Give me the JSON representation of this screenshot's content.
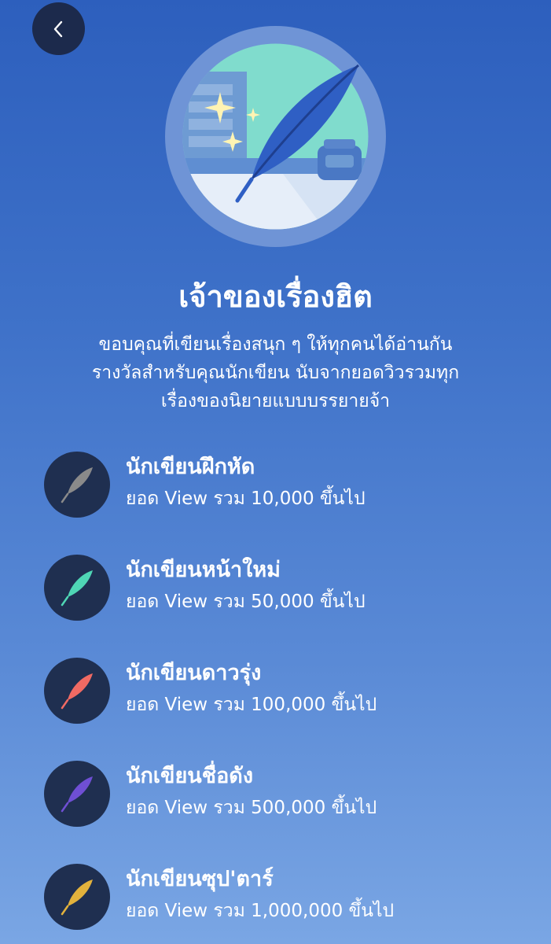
{
  "header": {
    "back_icon": "chevron-left-icon"
  },
  "badge": {
    "icon": "quill-feather-badge-icon"
  },
  "title": "เจ้าของเรื่องฮิต",
  "description": {
    "line1": "ขอบคุณที่เขียนเรื่องสนุก ๆ ให้ทุกคนได้อ่านกัน",
    "line2": "รางวัลสำหรับคุณนักเขียน นับจากยอดวิวรวมทุก",
    "line3": "เรื่องของนิยายแบบบรรยายจ้า"
  },
  "tiers": [
    {
      "name": "นักเขียนฝึกหัด",
      "requirement": "ยอด View รวม 10,000 ขึ้นไป",
      "color": "#8a8a8a",
      "icon": "feather-icon"
    },
    {
      "name": "นักเขียนหน้าใหม่",
      "requirement": "ยอด View รวม 50,000 ขึ้นไป",
      "color": "#4fd6b5",
      "icon": "feather-icon"
    },
    {
      "name": "นักเขียนดาวรุ่ง",
      "requirement": "ยอด View รวม 100,000 ขึ้นไป",
      "color": "#f06a63",
      "icon": "feather-icon"
    },
    {
      "name": "นักเขียนชื่อดัง",
      "requirement": "ยอด View รวม 500,000 ขึ้นไป",
      "color": "#6f4fd4",
      "icon": "feather-icon"
    },
    {
      "name": "นักเขียนซุป'ตาร์",
      "requirement": "ยอด View รวม 1,000,000 ขึ้นไป",
      "color": "#e2b23c",
      "icon": "feather-icon"
    }
  ]
}
